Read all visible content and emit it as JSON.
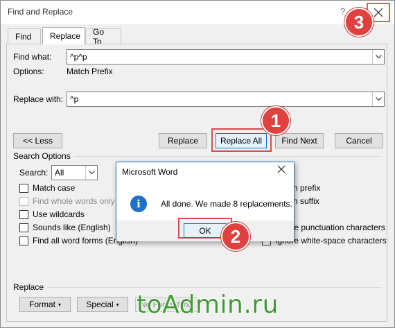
{
  "window": {
    "title": "Find and Replace",
    "help_label": "?"
  },
  "tabs": [
    {
      "label": "Find",
      "active": false
    },
    {
      "label": "Replace",
      "active": true
    },
    {
      "label": "Go To",
      "active": false
    }
  ],
  "find": {
    "label": "Find what:",
    "value": "^p^p",
    "options_label": "Options:",
    "options_value": "Match Prefix"
  },
  "replace": {
    "label": "Replace with:",
    "value": "^p"
  },
  "buttons": {
    "less": "<< Less",
    "replace": "Replace",
    "replace_all": "Replace All",
    "find_next": "Find Next",
    "cancel": "Cancel"
  },
  "search_options": {
    "title": "Search Options",
    "search_label": "Search:",
    "search_value": "All",
    "left_checkboxes": [
      {
        "label": "Match case",
        "checked": false,
        "disabled": false
      },
      {
        "label": "Find whole words only",
        "checked": false,
        "disabled": true
      },
      {
        "label": "Use wildcards",
        "checked": false,
        "disabled": false
      },
      {
        "label": "Sounds like (English)",
        "checked": false,
        "disabled": false
      },
      {
        "label": "Find all word forms (English)",
        "checked": false,
        "disabled": false
      }
    ],
    "right_checkboxes": [
      {
        "label": "Match prefix",
        "checked": true
      },
      {
        "label": "Match suffix",
        "checked": false
      },
      {
        "label": "Ignore punctuation characters",
        "checked": false
      },
      {
        "label": "Ignore white-space characters",
        "checked": false
      }
    ]
  },
  "replace_section": {
    "title": "Replace",
    "format": "Format",
    "special": "Special",
    "no_formatting": "No Formatting"
  },
  "message_box": {
    "title": "Microsoft Word",
    "text": "All done. We made 8 replacements.",
    "ok": "OK"
  },
  "step_badges": [
    "1",
    "2",
    "3"
  ],
  "watermark": "toAdmin.ru",
  "colors": {
    "highlight": "#d94c4c",
    "badge": "#e0413f",
    "accent": "#0078d7",
    "watermark": "#3f9a34"
  }
}
